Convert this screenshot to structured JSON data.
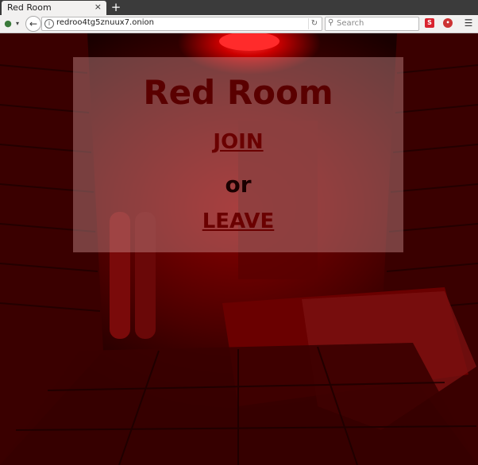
{
  "browser": {
    "tab_title": "Red Room",
    "tab_close": "×",
    "new_tab": "+",
    "url": "redroo4tg5znuux7.onion",
    "search_placeholder": "Search"
  },
  "page": {
    "title": "Red Room",
    "join_label": "JOIN",
    "or_label": "or",
    "leave_label": "LEAVE"
  },
  "colors": {
    "background_red": "#8a0000",
    "title_color": "#5a0000",
    "link_color": "#6a0000",
    "overlay": "rgba(210,150,150,0.42)"
  }
}
